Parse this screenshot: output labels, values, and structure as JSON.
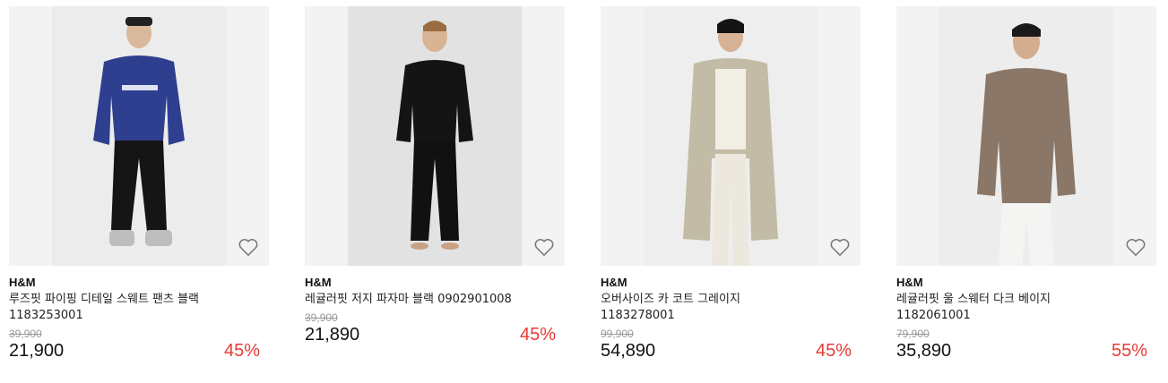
{
  "colors": {
    "discount": "#e53b37",
    "strike": "#999999",
    "image_bg": "#f3f3f3"
  },
  "products": [
    {
      "brand": "H&M",
      "title": "루즈핏 파이핑 디테일 스웨트 팬츠 블랙 1183253001",
      "original_price": "39,900",
      "price": "21,900",
      "discount": "45%",
      "wishlist_icon": "heart-outline-icon"
    },
    {
      "brand": "H&M",
      "title": "레귤러핏 저지 파자마 블랙 0902901008",
      "original_price": "39,900",
      "price": "21,890",
      "discount": "45%",
      "wishlist_icon": "heart-outline-icon"
    },
    {
      "brand": "H&M",
      "title": "오버사이즈 카 코트 그레이지 1183278001",
      "original_price": "99,900",
      "price": "54,890",
      "discount": "45%",
      "wishlist_icon": "heart-outline-icon"
    },
    {
      "brand": "H&M",
      "title": "레귤러핏 울 스웨터 다크 베이지 1182061001",
      "original_price": "79,900",
      "price": "35,890",
      "discount": "55%",
      "wishlist_icon": "heart-outline-icon"
    }
  ]
}
